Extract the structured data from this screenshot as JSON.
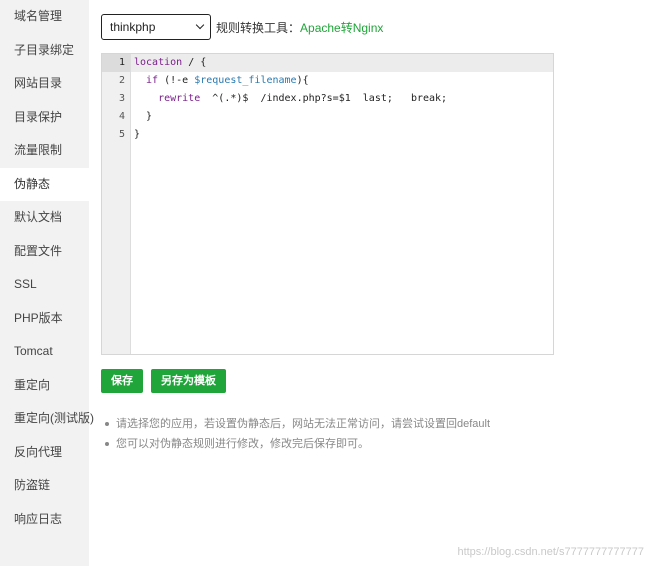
{
  "sidebar": {
    "items": [
      {
        "label": "域名管理"
      },
      {
        "label": "子目录绑定"
      },
      {
        "label": "网站目录"
      },
      {
        "label": "目录保护"
      },
      {
        "label": "流量限制"
      },
      {
        "label": "伪静态",
        "active": true
      },
      {
        "label": "默认文档"
      },
      {
        "label": "配置文件"
      },
      {
        "label": "SSL"
      },
      {
        "label": "PHP版本"
      },
      {
        "label": "Tomcat"
      },
      {
        "label": "重定向"
      },
      {
        "label": "重定向(测试版)"
      },
      {
        "label": "反向代理"
      },
      {
        "label": "防盗链"
      },
      {
        "label": "响应日志"
      }
    ]
  },
  "toolbar": {
    "template_select_value": "thinkphp",
    "convert_label": "规则转换工具：",
    "convert_link": "Apache转Nginx"
  },
  "editor": {
    "line_numbers": [
      "1",
      "2",
      "3",
      "4",
      "5"
    ],
    "active_line": 1,
    "lines": [
      [
        {
          "t": "location",
          "c": "kw"
        },
        {
          "t": " / {",
          "c": ""
        }
      ],
      [
        {
          "t": "  if",
          "c": "kw"
        },
        {
          "t": " (!-e ",
          "c": ""
        },
        {
          "t": "$request_filename",
          "c": "var"
        },
        {
          "t": "){",
          "c": ""
        }
      ],
      [
        {
          "t": "    rewrite",
          "c": "kw"
        },
        {
          "t": "  ^(.*)$  /index.php?s=$1  last;   break;",
          "c": ""
        }
      ],
      [
        {
          "t": "  }",
          "c": ""
        }
      ],
      [
        {
          "t": "}",
          "c": ""
        }
      ]
    ]
  },
  "buttons": {
    "save_label": "保存",
    "save_as_template_label": "另存为模板"
  },
  "tips": [
    "请选择您的应用，若设置伪静态后，网站无法正常访问，请尝试设置回default",
    "您可以对伪静态规则进行修改，修改完后保存即可。"
  ],
  "watermark": "https://blog.csdn.net/s7777777777777",
  "colors": {
    "accent": "#20a53a",
    "sidebar_bg": "#f2f2f2",
    "keyword": "#7a1f8a",
    "variable": "#2a7ab0"
  }
}
